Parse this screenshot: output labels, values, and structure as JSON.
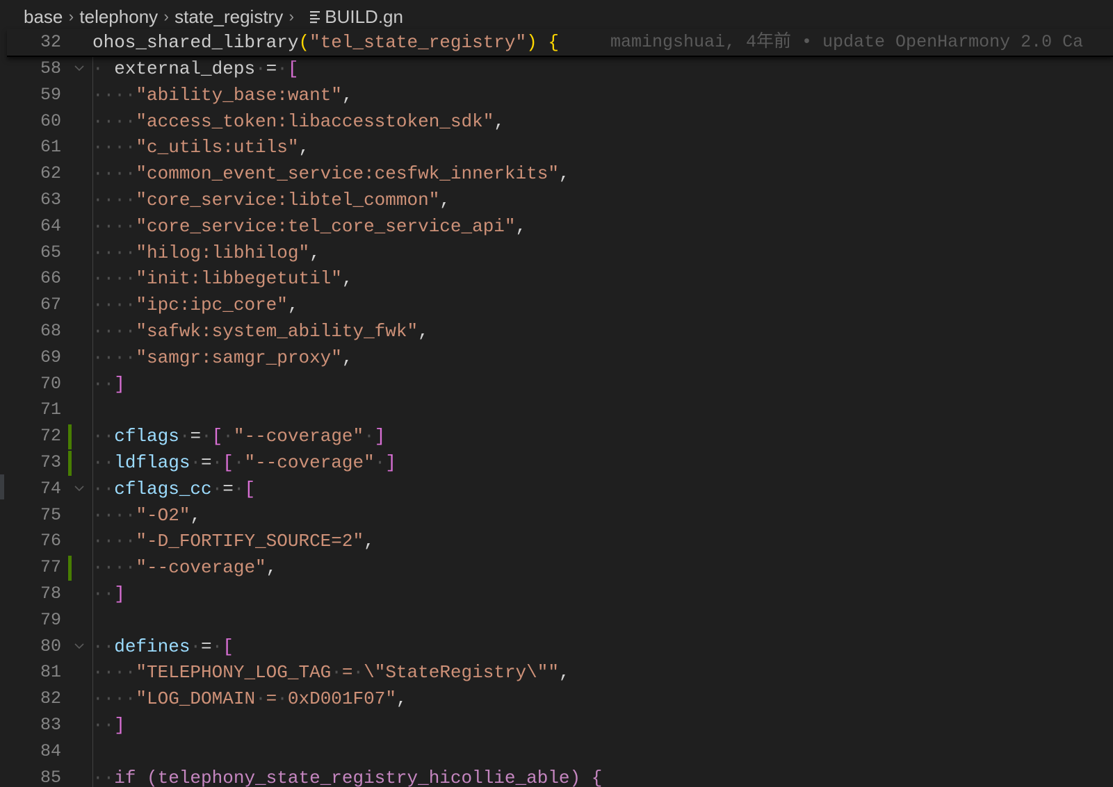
{
  "breadcrumb": {
    "items": [
      "base",
      "telephony",
      "state_registry"
    ],
    "file": "BUILD.gn"
  },
  "sticky": {
    "line_number": "32",
    "code": "ohos_shared_library",
    "open_paren": "(",
    "arg": "\"tel_state_registry\"",
    "close_paren": ")",
    "brace": " {",
    "blame": "mamingshuai, 4年前 • update OpenHarmony 2.0 Ca"
  },
  "lines": [
    {
      "n": "58",
      "fold": true,
      "tokens": [
        [
          "ws",
          "·"
        ],
        [
          "ident",
          " external_deps"
        ],
        [
          "ws",
          "·"
        ],
        [
          "op",
          "="
        ],
        [
          "ws",
          "·"
        ],
        [
          "brack",
          "["
        ]
      ]
    },
    {
      "n": "59",
      "tokens": [
        [
          "ws",
          "····"
        ],
        [
          "str",
          "\"ability_base:want\""
        ],
        [
          "op",
          ","
        ]
      ]
    },
    {
      "n": "60",
      "tokens": [
        [
          "ws",
          "····"
        ],
        [
          "str",
          "\"access_token:libaccesstoken_sdk\""
        ],
        [
          "op",
          ","
        ]
      ]
    },
    {
      "n": "61",
      "tokens": [
        [
          "ws",
          "····"
        ],
        [
          "str",
          "\"c_utils:utils\""
        ],
        [
          "op",
          ","
        ]
      ]
    },
    {
      "n": "62",
      "tokens": [
        [
          "ws",
          "····"
        ],
        [
          "str",
          "\"common_event_service:cesfwk_innerkits\""
        ],
        [
          "op",
          ","
        ]
      ]
    },
    {
      "n": "63",
      "tokens": [
        [
          "ws",
          "····"
        ],
        [
          "str",
          "\"core_service:libtel_common\""
        ],
        [
          "op",
          ","
        ]
      ]
    },
    {
      "n": "64",
      "tokens": [
        [
          "ws",
          "····"
        ],
        [
          "str",
          "\"core_service:tel_core_service_api\""
        ],
        [
          "op",
          ","
        ]
      ]
    },
    {
      "n": "65",
      "tokens": [
        [
          "ws",
          "····"
        ],
        [
          "str",
          "\"hilog:libhilog\""
        ],
        [
          "op",
          ","
        ]
      ]
    },
    {
      "n": "66",
      "tokens": [
        [
          "ws",
          "····"
        ],
        [
          "str",
          "\"init:libbegetutil\""
        ],
        [
          "op",
          ","
        ]
      ]
    },
    {
      "n": "67",
      "tokens": [
        [
          "ws",
          "····"
        ],
        [
          "str",
          "\"ipc:ipc_core\""
        ],
        [
          "op",
          ","
        ]
      ]
    },
    {
      "n": "68",
      "tokens": [
        [
          "ws",
          "····"
        ],
        [
          "str",
          "\"safwk:system_ability_fwk\""
        ],
        [
          "op",
          ","
        ]
      ]
    },
    {
      "n": "69",
      "tokens": [
        [
          "ws",
          "····"
        ],
        [
          "str",
          "\"samgr:samgr_proxy\""
        ],
        [
          "op",
          ","
        ]
      ]
    },
    {
      "n": "70",
      "tokens": [
        [
          "ws",
          "··"
        ],
        [
          "brack",
          "]"
        ]
      ]
    },
    {
      "n": "71",
      "tokens": []
    },
    {
      "n": "72",
      "git": true,
      "tokens": [
        [
          "ws",
          "··"
        ],
        [
          "var",
          "cflags"
        ],
        [
          "ws",
          "·"
        ],
        [
          "op",
          "="
        ],
        [
          "ws",
          "·"
        ],
        [
          "brack",
          "["
        ],
        [
          "ws",
          "·"
        ],
        [
          "str",
          "\"--coverage\""
        ],
        [
          "ws",
          "·"
        ],
        [
          "brack",
          "]"
        ]
      ]
    },
    {
      "n": "73",
      "git": true,
      "tokens": [
        [
          "ws",
          "··"
        ],
        [
          "var",
          "ldflags"
        ],
        [
          "ws",
          "·"
        ],
        [
          "op",
          "="
        ],
        [
          "ws",
          "·"
        ],
        [
          "brack",
          "["
        ],
        [
          "ws",
          "·"
        ],
        [
          "str",
          "\"--coverage\""
        ],
        [
          "ws",
          "·"
        ],
        [
          "brack",
          "]"
        ]
      ]
    },
    {
      "n": "74",
      "fold": true,
      "tokens": [
        [
          "ws",
          "··"
        ],
        [
          "var",
          "cflags_cc"
        ],
        [
          "ws",
          "·"
        ],
        [
          "op",
          "="
        ],
        [
          "ws",
          "·"
        ],
        [
          "brack",
          "["
        ]
      ]
    },
    {
      "n": "75",
      "tokens": [
        [
          "ws",
          "····"
        ],
        [
          "str",
          "\"-O2\""
        ],
        [
          "op",
          ","
        ]
      ]
    },
    {
      "n": "76",
      "tokens": [
        [
          "ws",
          "····"
        ],
        [
          "str",
          "\"-D_FORTIFY_SOURCE=2\""
        ],
        [
          "op",
          ","
        ]
      ]
    },
    {
      "n": "77",
      "git": true,
      "tokens": [
        [
          "ws",
          "····"
        ],
        [
          "str",
          "\"--coverage\""
        ],
        [
          "op",
          ","
        ]
      ]
    },
    {
      "n": "78",
      "tokens": [
        [
          "ws",
          "··"
        ],
        [
          "brack",
          "]"
        ]
      ]
    },
    {
      "n": "79",
      "tokens": []
    },
    {
      "n": "80",
      "fold": true,
      "tokens": [
        [
          "ws",
          "··"
        ],
        [
          "var",
          "defines"
        ],
        [
          "ws",
          "·"
        ],
        [
          "op",
          "="
        ],
        [
          "ws",
          "·"
        ],
        [
          "brack",
          "["
        ]
      ]
    },
    {
      "n": "81",
      "tokens": [
        [
          "ws",
          "····"
        ],
        [
          "str",
          "\"TELEPHONY_LOG_TAG"
        ],
        [
          "ws",
          "·"
        ],
        [
          "str",
          "="
        ],
        [
          "ws",
          "·"
        ],
        [
          "str",
          "\\\"StateRegistry\\\"\""
        ],
        [
          "op",
          ","
        ]
      ]
    },
    {
      "n": "82",
      "tokens": [
        [
          "ws",
          "····"
        ],
        [
          "str",
          "\"LOG_DOMAIN"
        ],
        [
          "ws",
          "·"
        ],
        [
          "str",
          "="
        ],
        [
          "ws",
          "·"
        ],
        [
          "str",
          "0xD001F07\""
        ],
        [
          "op",
          ","
        ]
      ]
    },
    {
      "n": "83",
      "tokens": [
        [
          "ws",
          "··"
        ],
        [
          "brack",
          "]"
        ]
      ]
    },
    {
      "n": "84",
      "tokens": []
    },
    {
      "n": "85",
      "tokens": [
        [
          "ws",
          "··"
        ],
        [
          "cut",
          "if (telephony_state_registry_hicollie_able) {"
        ]
      ]
    }
  ],
  "colors": {
    "background": "#1f1f1f",
    "string": "#ce9178",
    "variable": "#9cdcfe",
    "bracket": "#da70d6",
    "paren": "#ffd700",
    "git_added": "#487e02",
    "line_number": "#858585"
  },
  "icons": {
    "breadcrumb_separator": "chevron-right-icon",
    "file": "file-lines-icon",
    "fold": "chevron-down-icon"
  }
}
